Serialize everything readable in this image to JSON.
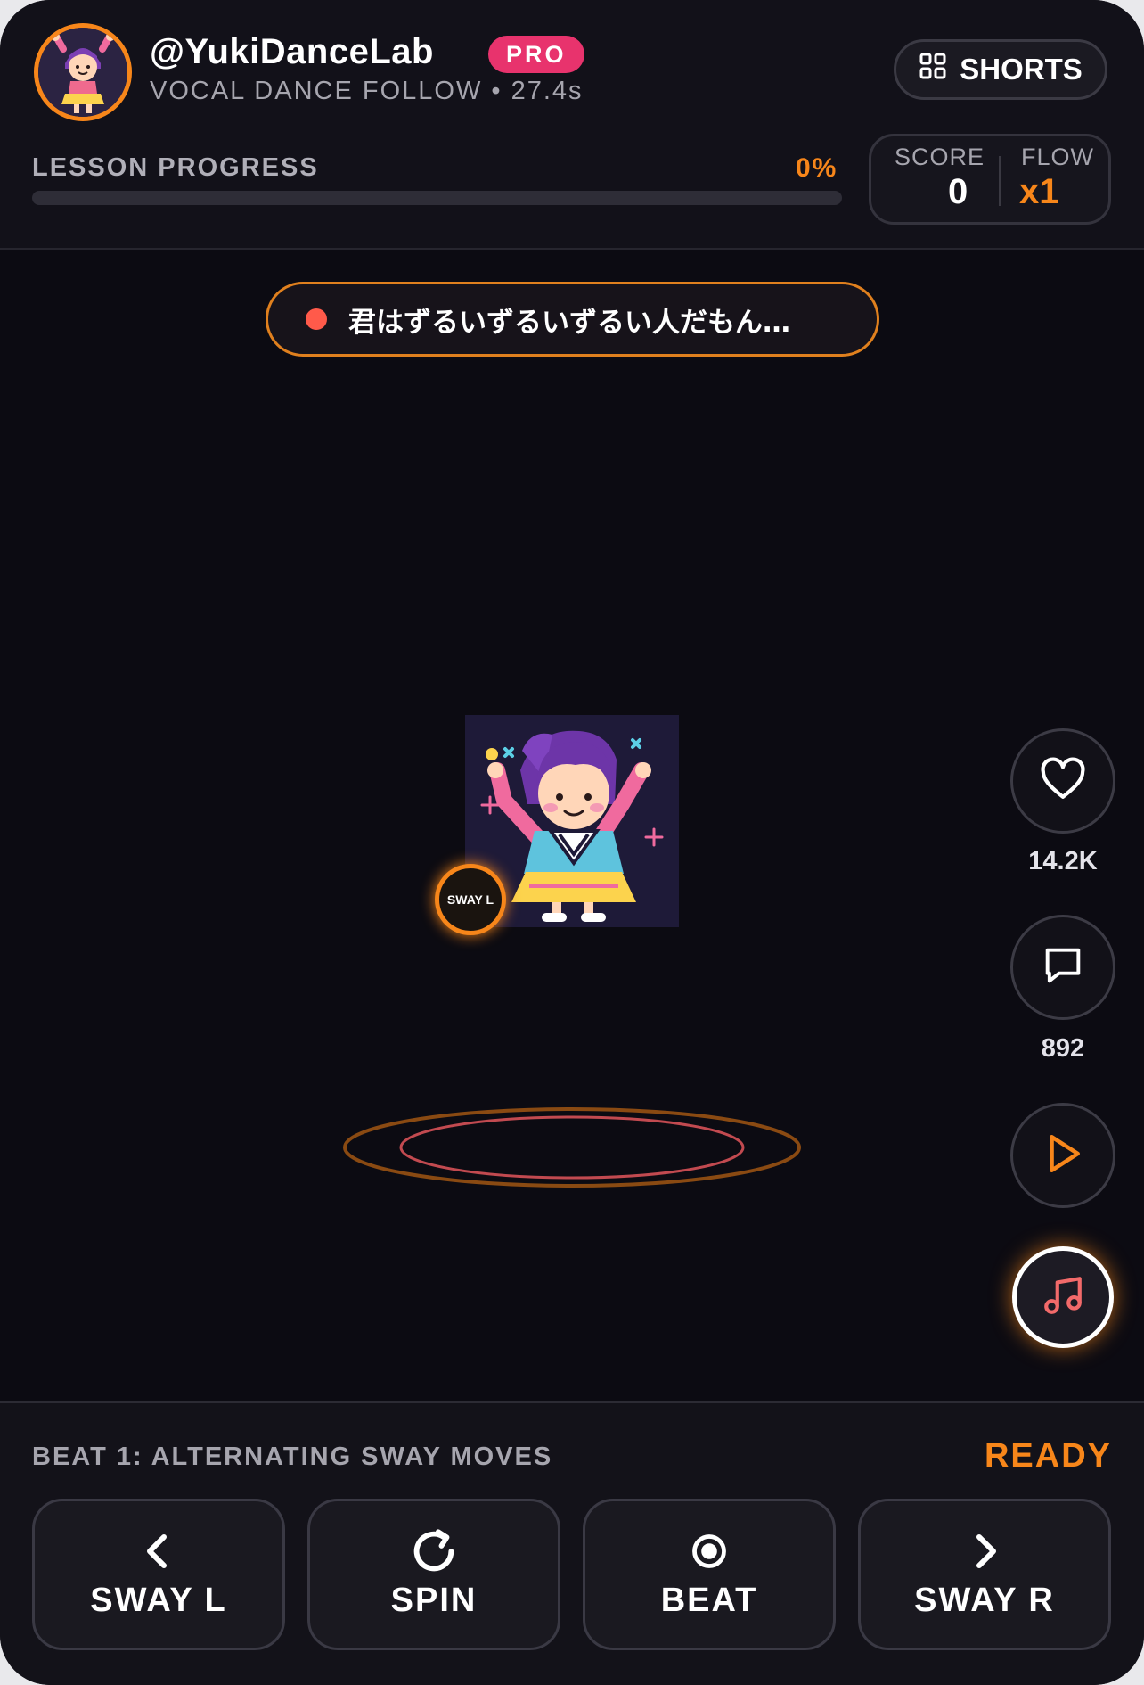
{
  "header": {
    "handle": "@YukiDanceLab",
    "badge": "PRO",
    "subtitle": "VOCAL DANCE FOLLOW • 27.4s",
    "shorts_label": "SHORTS"
  },
  "progress": {
    "label": "LESSON PROGRESS",
    "percent_text": "0%",
    "value": 0
  },
  "score": {
    "score_label": "SCORE",
    "score_value": "0",
    "flow_label": "FLOW",
    "flow_value": "x1"
  },
  "stage": {
    "lyric": "君はずるいずるいずるい人だもん…",
    "move_marker": "SWAY L"
  },
  "actions": {
    "likes": "14.2K",
    "comments": "892"
  },
  "panel": {
    "beat_title": "BEAT 1: ALTERNATING SWAY MOVES",
    "status": "READY",
    "moves": [
      {
        "label": "SWAY L",
        "icon": "chevron-left-icon"
      },
      {
        "label": "SPIN",
        "icon": "rotate-icon"
      },
      {
        "label": "BEAT",
        "icon": "target-icon"
      },
      {
        "label": "SWAY R",
        "icon": "chevron-right-icon"
      }
    ]
  },
  "colors": {
    "accent": "#f7861a",
    "pro": "#e8336d",
    "record": "#ff5a4a",
    "background": "#0c0b12"
  }
}
